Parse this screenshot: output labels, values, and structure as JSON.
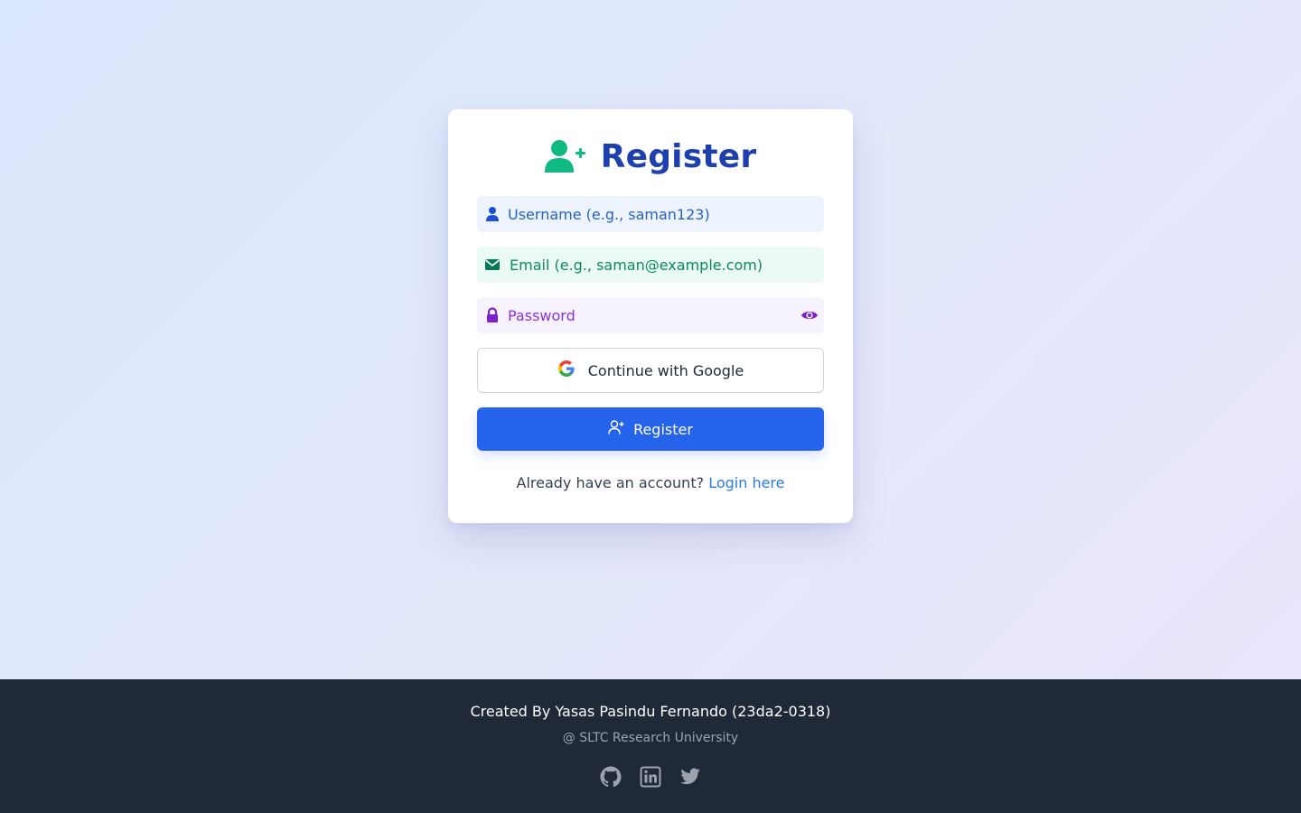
{
  "form": {
    "title": "Register",
    "title_icon": "user-plus-icon",
    "username_placeholder": "Username (e.g., saman123)",
    "email_placeholder": "Email (e.g., saman@example.com)",
    "password_placeholder": "Password",
    "google_label": "Continue with Google",
    "register_label": "Register",
    "login_prompt": "Already have an account?",
    "login_link": "Login here"
  },
  "footer": {
    "credit": "Created By Yasas Pasindu Fernando (23da2-0318)",
    "org": "@ SLTC Research University",
    "social_icons": [
      "github-icon",
      "linkedin-icon",
      "twitter-icon"
    ]
  },
  "colors": {
    "title": "#1e40af",
    "title_icon": "#10b981",
    "primary_button": "#2563eb",
    "username_bg": "#eef4fe",
    "email_bg": "#ebfbf3",
    "password_bg": "#f6f2fe",
    "footer_bg": "#1f2937"
  }
}
